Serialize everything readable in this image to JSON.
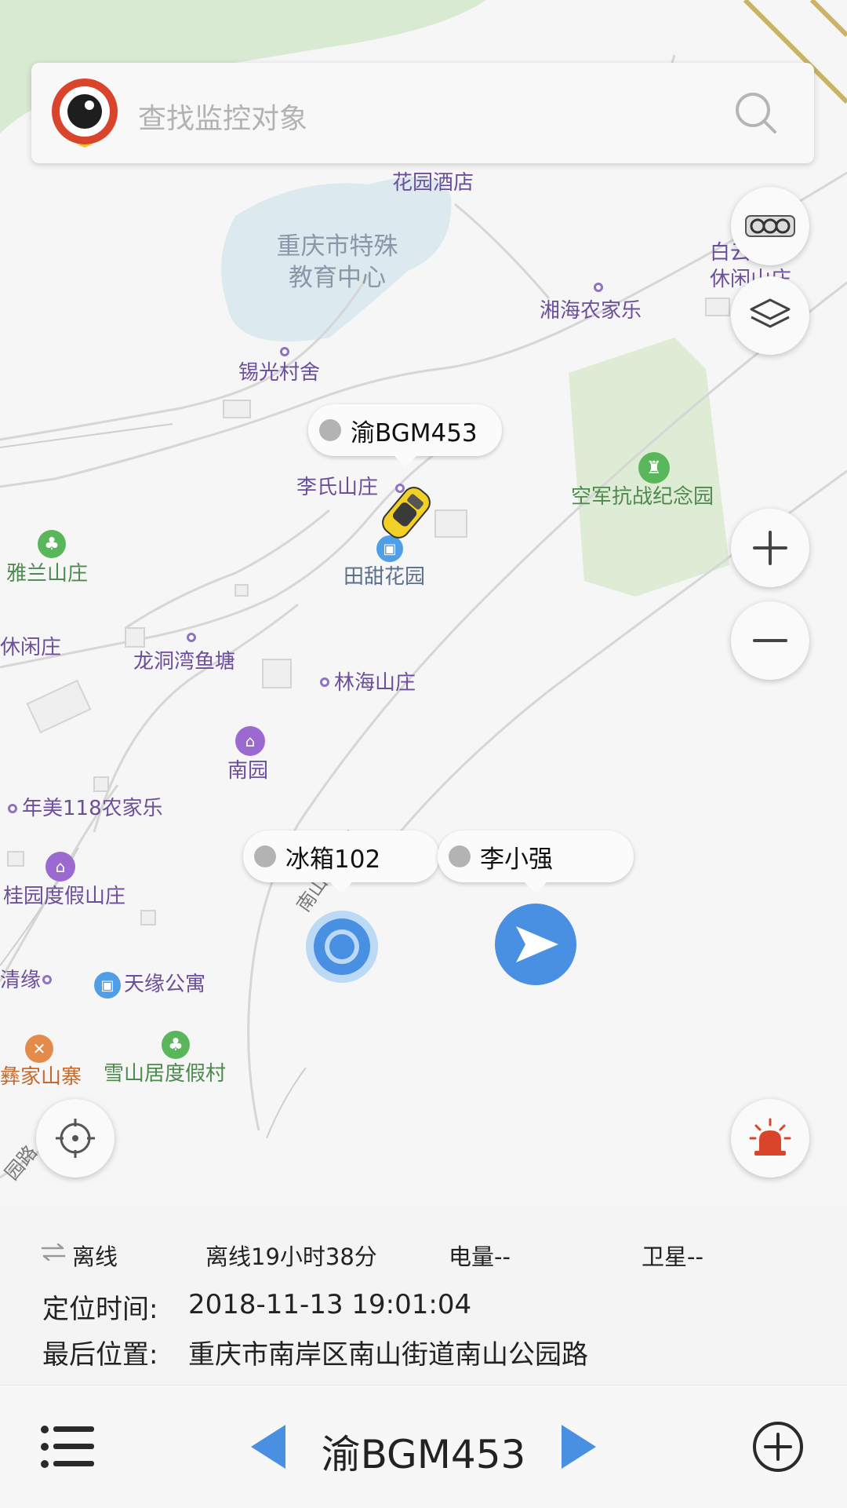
{
  "search": {
    "placeholder": "查找监控对象",
    "logo_icon": "eye-logo-icon",
    "search_icon": "search-icon"
  },
  "map_controls": {
    "traffic_icon": "traffic-icon",
    "layers_icon": "layers-icon",
    "zoom_in_icon": "plus-icon",
    "zoom_out_icon": "minus-icon",
    "locate_icon": "crosshair-icon",
    "alarm_icon": "alarm-siren-icon"
  },
  "map_labels": {
    "hotel": "花园酒店",
    "school": "重庆市特殊\n教育中心",
    "xiguang": "锡光村舍",
    "xianghai": "湘海农家乐",
    "baiyun": "白云山\n休闲山庄",
    "lishi": "李氏山庄",
    "kongjun": "空军抗战纪念园",
    "yalan": "雅兰山庄",
    "tiantian": "田甜花园",
    "xiuxian": "休闲庄",
    "longdong": "龙洞湾鱼塘",
    "linhai": "林海山庄",
    "nanyuan": "南园",
    "nianmei": "年美118农家乐",
    "guiyuan": "桂园度假山庄",
    "qingyuan": "清缘",
    "tianyuan": "天缘公寓",
    "yijia": "彝家山寨",
    "xueshan": "雪山居度假村",
    "road1": "南山公园路",
    "road2": "园路"
  },
  "targets": [
    {
      "name": "渝BGM453",
      "type": "car",
      "status_color": "#b3b3b3"
    },
    {
      "name": "冰箱102",
      "type": "device",
      "status_color": "#b3b3b3"
    },
    {
      "name": "李小强",
      "type": "person",
      "status_color": "#b3b3b3"
    }
  ],
  "info": {
    "status_icon": "offline-arrows-icon",
    "status": "离线",
    "offline_duration": "离线19小时38分",
    "battery": "电量--",
    "satellite": "卫星--",
    "time_label": "定位时间:",
    "time_value": "2018-11-13 19:01:04",
    "location_label": "最后位置:",
    "location_value": "重庆市南岸区南山街道南山公园路"
  },
  "bottom": {
    "menu_icon": "list-menu-icon",
    "prev_icon": "prev-triangle-icon",
    "current": "渝BGM453",
    "next_icon": "next-triangle-icon",
    "add_icon": "add-circle-icon"
  },
  "colors": {
    "accent_blue": "#4a90e2",
    "alarm_red": "#d8452b",
    "park_green": "#d8ead2",
    "water": "#dce9ee"
  }
}
